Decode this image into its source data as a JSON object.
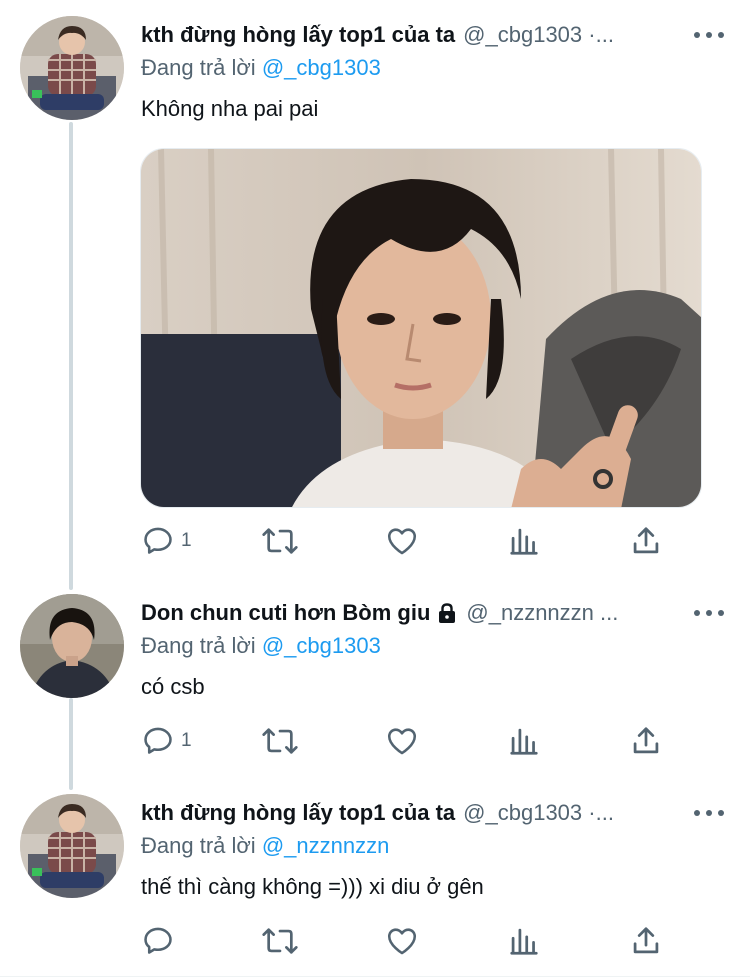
{
  "tweets": [
    {
      "name": "kth đừng hòng lấy top1 của ta",
      "handle": "@_cbg1303 ·...",
      "locked": false,
      "replying_prefix": "Đang trả lời",
      "replying_to": "@_cbg1303",
      "text": "Không nha pai pai",
      "has_media": true,
      "reply_count": "1",
      "avatar_icon": "avatar-kth",
      "media_icon": "photo-person"
    },
    {
      "name": "Don chun cuti hơn Bòm giu",
      "handle": "@_nzznnzzn ...",
      "locked": true,
      "replying_prefix": "Đang trả lời",
      "replying_to": "@_cbg1303",
      "text": "có csb",
      "has_media": false,
      "reply_count": "1",
      "avatar_icon": "avatar-don"
    },
    {
      "name": "kth đừng hòng lấy top1 của ta",
      "handle": "@_cbg1303 ·...",
      "locked": false,
      "replying_prefix": "Đang trả lời",
      "replying_to": "@_nzznnzzn",
      "text": "thế thì càng không =))) xi diu ở gên",
      "has_media": false,
      "reply_count": "",
      "avatar_icon": "avatar-kth"
    }
  ],
  "icons": {
    "reply": "reply-icon",
    "retweet": "retweet-icon",
    "like": "heart-icon",
    "views": "views-icon",
    "share": "share-icon",
    "more": "more-icon",
    "lock": "lock-icon"
  },
  "colors": {
    "text": "#0f1419",
    "secondary": "#536471",
    "link": "#1d9bf0",
    "thread_line": "#cfd9de"
  }
}
